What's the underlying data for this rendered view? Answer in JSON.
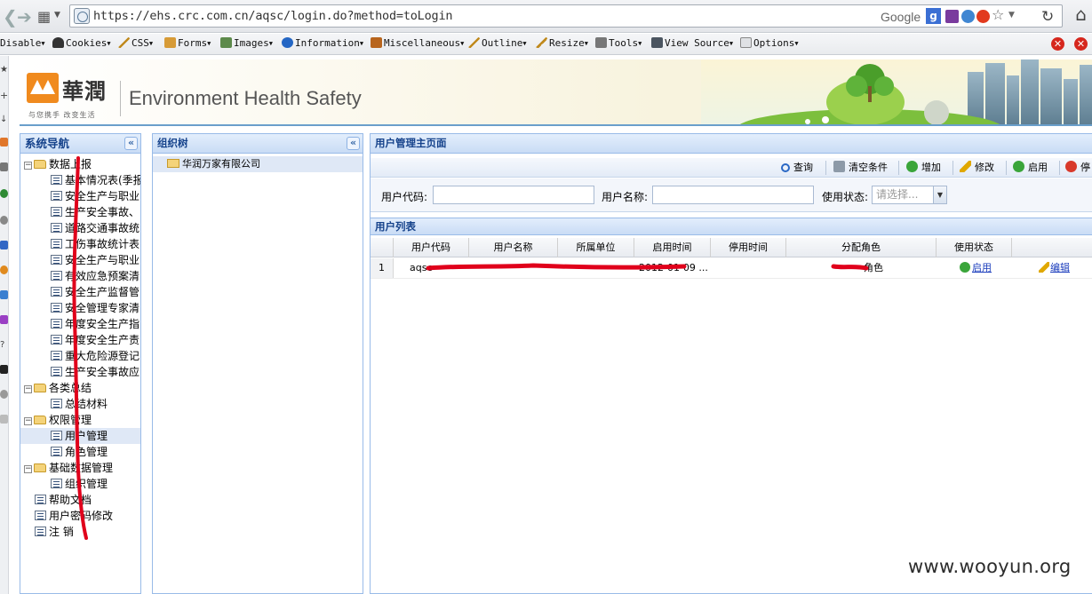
{
  "browser": {
    "url": "https://ehs.crc.com.cn/aqsc/login.do?method=toLogin",
    "search_engine": "Google"
  },
  "devtoolbar": {
    "items": [
      "Disable",
      "Cookies",
      "CSS",
      "Forms",
      "Images",
      "Information",
      "Miscellaneous",
      "Outline",
      "Resize",
      "Tools",
      "View Source",
      "Options"
    ]
  },
  "banner": {
    "logo_text": "華潤",
    "slogan": "与您携手 改变生活",
    "title": "Environment Health Safety"
  },
  "nav": {
    "title": "系统导航",
    "items": [
      {
        "label": "数据上报",
        "kind": "folder"
      },
      {
        "label": "基本情况表(季报",
        "kind": "leaf"
      },
      {
        "label": "安全生产与职业",
        "kind": "leaf"
      },
      {
        "label": "生产安全事故、",
        "kind": "leaf"
      },
      {
        "label": "道路交通事故统",
        "kind": "leaf"
      },
      {
        "label": "工伤事故统计表",
        "kind": "leaf"
      },
      {
        "label": "安全生产与职业",
        "kind": "leaf"
      },
      {
        "label": "有效应急预案清",
        "kind": "leaf"
      },
      {
        "label": "安全生产监督管",
        "kind": "leaf"
      },
      {
        "label": "安全管理专家清",
        "kind": "leaf"
      },
      {
        "label": "年度安全生产指",
        "kind": "leaf"
      },
      {
        "label": "年度安全生产责",
        "kind": "leaf"
      },
      {
        "label": "重大危险源登记",
        "kind": "leaf"
      },
      {
        "label": "生产安全事故应",
        "kind": "leaf"
      },
      {
        "label": "各类总结",
        "kind": "folder"
      },
      {
        "label": "总结材料",
        "kind": "leaf"
      },
      {
        "label": "权限管理",
        "kind": "folder"
      },
      {
        "label": "用户管理",
        "kind": "leaf",
        "selected": true
      },
      {
        "label": "角色管理",
        "kind": "leaf"
      },
      {
        "label": "基础数据管理",
        "kind": "folder"
      },
      {
        "label": "组织管理",
        "kind": "leaf"
      },
      {
        "label": "帮助文档",
        "kind": "root-leaf"
      },
      {
        "label": "用户密码修改",
        "kind": "root-leaf"
      },
      {
        "label": "注 销",
        "kind": "root-leaf"
      }
    ]
  },
  "org": {
    "title": "组织树",
    "root": "华润万家有限公司"
  },
  "main": {
    "title": "用户管理主页面",
    "toolbar": {
      "query": "查询",
      "clear": "清空条件",
      "add": "增加",
      "edit": "修改",
      "enable": "启用",
      "disable": "停"
    },
    "filters": {
      "user_code_label": "用户代码:",
      "user_name_label": "用户名称:",
      "state_label": "使用状态:",
      "state_placeholder": "请选择..."
    },
    "list_title": "用户列表",
    "columns": [
      "用户代码",
      "用户名称",
      "所属单位",
      "启用时间",
      "停用时间",
      "分配角色",
      "使用状态"
    ],
    "rows": [
      {
        "num": "1",
        "code": "aqsc",
        "name": "",
        "unit": "",
        "start_time": "2012-01-09 ...",
        "stop_time": "",
        "role": "角色",
        "state": "启用",
        "action": "编辑"
      }
    ]
  },
  "watermark": "www.wooyun.org",
  "colors": {
    "panel_border": "#99bbe8",
    "panel_title": "#15428b",
    "redaction": "#e0001b",
    "link": "#1a3cbc"
  }
}
